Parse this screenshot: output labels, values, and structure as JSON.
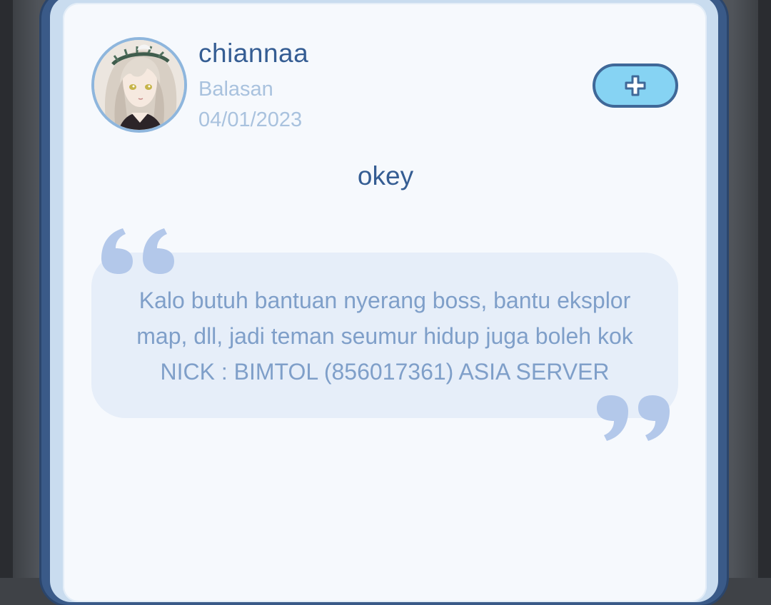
{
  "profile": {
    "username": "chiannaa",
    "subtitle": "Balasan",
    "date": "04/01/2023"
  },
  "actions": {
    "add_icon": "plus-icon"
  },
  "message": {
    "title": "okey",
    "quote_lines": [
      "Kalo butuh bantuan nyerang boss, bantu eksplor",
      "map, dll, jadi teman seumur hidup juga boleh kok",
      "NICK : BIMTOL (856017361) ASIA SERVER"
    ]
  },
  "colors": {
    "accent": "#355d93",
    "muted": "#a9c2de",
    "quote_text": "#7f9fc9",
    "quote_bg": "#e6eef9",
    "button_bg": "#86d3f3"
  }
}
